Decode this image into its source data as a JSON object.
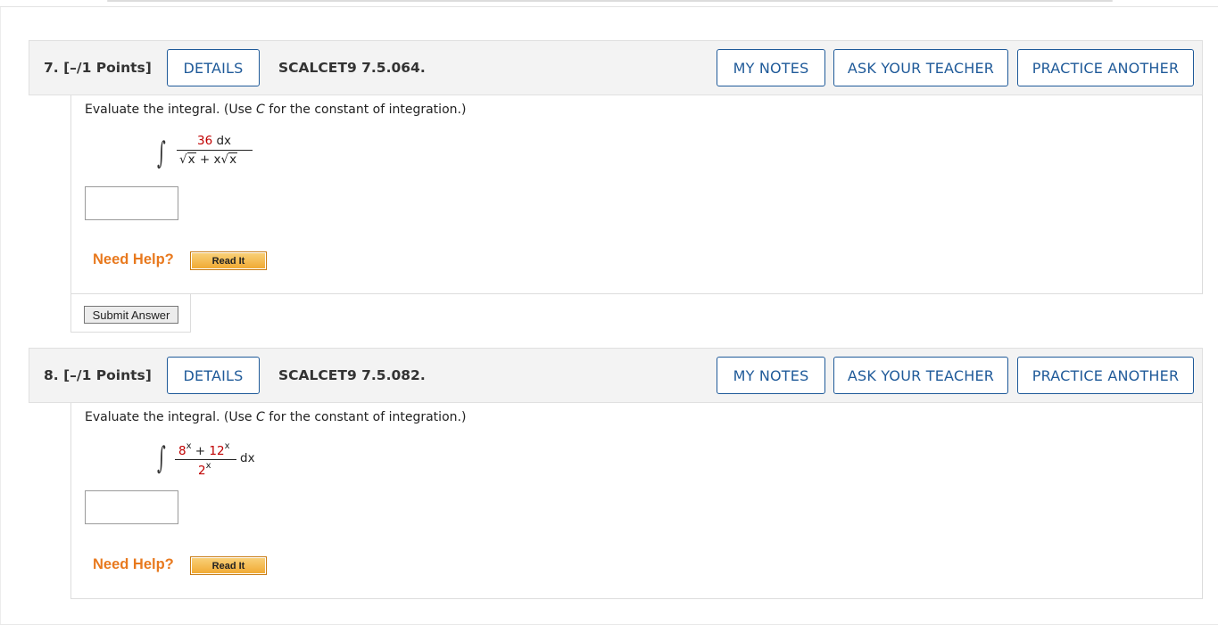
{
  "questions": [
    {
      "number_label": "7. [–/1 Points]",
      "details_label": "DETAILS",
      "code": "SCALCET9 7.5.064.",
      "my_notes_label": "MY NOTES",
      "ask_teacher_label": "ASK YOUR TEACHER",
      "practice_label": "PRACTICE ANOTHER",
      "prompt_pre": "Evaluate the integral. (Use ",
      "prompt_var": "C",
      "prompt_post": " for the constant of integration.)",
      "integral": {
        "sign": "∫",
        "numerator_coef": "36",
        "numerator_var": "dx",
        "den_rad1": "x",
        "den_mid": " + x",
        "den_rad2": "x",
        "radical_sym": "√"
      },
      "answer_value": "",
      "need_help_label": "Need Help?",
      "read_it_label": "Read It",
      "submit_label": "Submit Answer"
    },
    {
      "number_label": "8. [–/1 Points]",
      "details_label": "DETAILS",
      "code": "SCALCET9 7.5.082.",
      "my_notes_label": "MY NOTES",
      "ask_teacher_label": "ASK YOUR TEACHER",
      "practice_label": "PRACTICE ANOTHER",
      "prompt_pre": "Evaluate the integral. (Use ",
      "prompt_var": "C",
      "prompt_post": " for the constant of integration.)",
      "integral": {
        "sign": "∫",
        "num_base1": "8",
        "num_exp1": "x",
        "num_plus": " + ",
        "num_base2": "12",
        "num_exp2": "x",
        "den_base": "2",
        "den_exp": "x",
        "differential": "dx"
      },
      "answer_value": "",
      "need_help_label": "Need Help?",
      "read_it_label": "Read It"
    }
  ],
  "colors": {
    "accent_blue": "#1f5a99",
    "help_orange": "#e8791e",
    "math_red": "#c00000"
  }
}
